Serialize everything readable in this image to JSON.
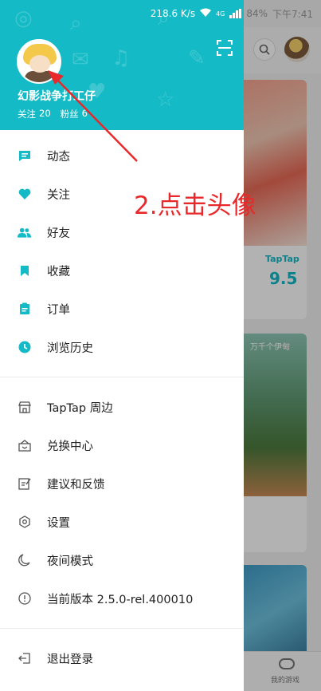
{
  "status_bar": {
    "speed": "218.6 K/s",
    "network": "4G",
    "battery": "84%",
    "time": "下午7:41"
  },
  "background": {
    "card_brand": "TapTap",
    "card_score": "9.5",
    "card_game_title": "万千个伊甸",
    "bottom_nav_label": "我的游戏"
  },
  "profile": {
    "username": "幻影战争打工仔",
    "following_label": "关注",
    "following_count": "20",
    "followers_label": "粉丝",
    "followers_count": "6"
  },
  "menu_primary": [
    {
      "label": "动态",
      "icon": "feed-icon"
    },
    {
      "label": "关注",
      "icon": "heart-icon"
    },
    {
      "label": "好友",
      "icon": "friends-icon"
    },
    {
      "label": "收藏",
      "icon": "bookmark-icon"
    },
    {
      "label": "订单",
      "icon": "order-icon"
    },
    {
      "label": "浏览历史",
      "icon": "clock-icon"
    }
  ],
  "menu_secondary": [
    {
      "label": "TapTap 周边",
      "icon": "store-icon"
    },
    {
      "label": "兑换中心",
      "icon": "redeem-icon"
    },
    {
      "label": "建议和反馈",
      "icon": "feedback-icon"
    },
    {
      "label": "设置",
      "icon": "settings-icon"
    },
    {
      "label": "夜间模式",
      "icon": "moon-icon"
    },
    {
      "label": "当前版本 2.5.0-rel.400010",
      "icon": "info-icon"
    }
  ],
  "menu_logout": {
    "label": "退出登录",
    "icon": "logout-icon"
  },
  "annotation": {
    "text": "2.点击头像"
  },
  "colors": {
    "accent": "#14bbc6",
    "annotation": "#e8282a",
    "text": "#222222"
  }
}
